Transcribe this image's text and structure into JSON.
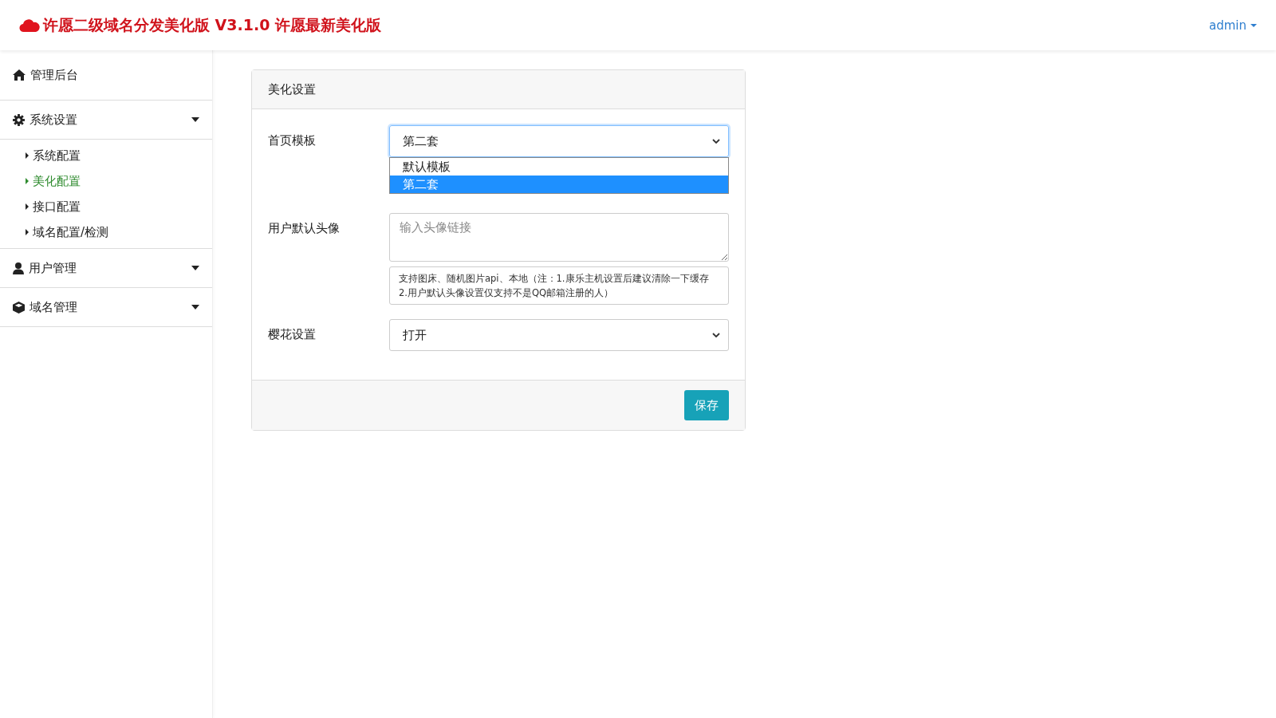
{
  "header": {
    "title": "许愿二级域名分发美化版 V3.1.0 许愿最新美化版",
    "user_menu": "admin"
  },
  "sidebar": {
    "items": [
      {
        "label": "管理后台",
        "kind": "link"
      },
      {
        "label": "系统设置",
        "kind": "group",
        "expanded": true,
        "children": [
          {
            "label": "系统配置",
            "selected": false
          },
          {
            "label": "美化配置",
            "selected": true
          },
          {
            "label": "接口配置",
            "selected": false
          },
          {
            "label": "域名配置/检测",
            "selected": false
          }
        ]
      },
      {
        "label": "用户管理",
        "kind": "group"
      },
      {
        "label": "域名管理",
        "kind": "group"
      }
    ]
  },
  "card": {
    "title": "美化设置",
    "fields": [
      {
        "kind": "select",
        "label": "首页模板",
        "value": "第二套",
        "open": true,
        "options": [
          {
            "label": "默认模板",
            "selected": false
          },
          {
            "label": "第二套",
            "selected": true
          }
        ]
      },
      {
        "kind": "textarea",
        "label": "用户默认头像",
        "placeholder": "输入头像链接",
        "help": "支持图床、随机图片api、本地（注：1.康乐主机设置后建议清除一下缓存 2.用户默认头像设置仅支持不是QQ邮箱注册的人）"
      },
      {
        "kind": "select",
        "label": "樱花设置",
        "value": "打开",
        "open": false
      }
    ],
    "button": "保存"
  }
}
